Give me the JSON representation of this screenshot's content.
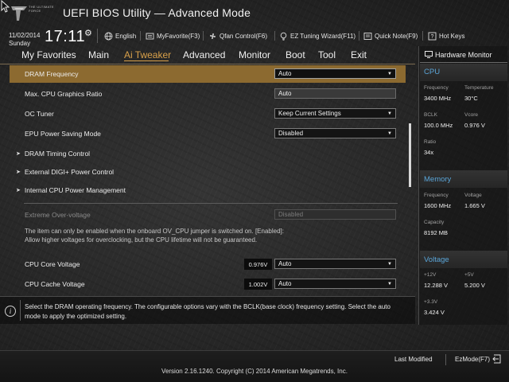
{
  "header": {
    "logo_text": "THE ULTIMATE FORCE",
    "title": "UEFI BIOS Utility — Advanced Mode",
    "date": "11/02/2014",
    "day": "Sunday",
    "time": "17:11",
    "tools": [
      {
        "label": "English",
        "icon": "globe-icon"
      },
      {
        "label": "MyFavorite(F3)",
        "icon": "favorite-icon"
      },
      {
        "label": "Qfan Control(F6)",
        "icon": "fan-icon"
      },
      {
        "label": "EZ Tuning Wizard(F11)",
        "icon": "lightbulb-icon"
      },
      {
        "label": "Quick Note(F9)",
        "icon": "note-icon"
      },
      {
        "label": "Hot Keys",
        "icon": "help-icon"
      }
    ]
  },
  "tabs": [
    {
      "label": "My Favorites",
      "active": false
    },
    {
      "label": "Main",
      "active": false
    },
    {
      "label": "Ai Tweaker",
      "active": true
    },
    {
      "label": "Advanced",
      "active": false
    },
    {
      "label": "Monitor",
      "active": false
    },
    {
      "label": "Boot",
      "active": false
    },
    {
      "label": "Tool",
      "active": false
    },
    {
      "label": "Exit",
      "active": false
    }
  ],
  "settings": {
    "dram_frequency": {
      "label": "DRAM Frequency",
      "value": "Auto"
    },
    "cpu_graphics_ratio": {
      "label": "Max. CPU Graphics Ratio",
      "value": "Auto"
    },
    "oc_tuner": {
      "label": "OC Tuner",
      "value": "Keep Current Settings"
    },
    "epu_power": {
      "label": "EPU Power Saving Mode",
      "value": "Disabled"
    },
    "dram_timing": {
      "label": "DRAM Timing Control"
    },
    "digi_power": {
      "label": "External DIGI+ Power Control"
    },
    "internal_cpu_power": {
      "label": "Internal CPU Power Management"
    },
    "extreme_overvoltage": {
      "label": "Extreme Over-voltage",
      "value": "Disabled"
    },
    "help_note": "The item can only be enabled when the onboard OV_CPU jumper is switched on. [Enabled]: Allow higher voltages for overclocking, but the CPU lifetime will not be guaranteed.",
    "cpu_core_voltage": {
      "label": "CPU Core Voltage",
      "reading": "0.976V",
      "value": "Auto"
    },
    "cpu_cache_voltage": {
      "label": "CPU Cache Voltage",
      "reading": "1.002V",
      "value": "Auto"
    }
  },
  "info_text": "Select the DRAM operating frequency. The configurable options vary with the BCLK(base clock) frequency setting. Select the auto mode to apply the optimized setting.",
  "hardware_monitor": {
    "title": "Hardware Monitor",
    "cpu": {
      "heading": "CPU",
      "frequency_label": "Frequency",
      "frequency": "3400 MHz",
      "temperature_label": "Temperature",
      "temperature": "30°C",
      "bclk_label": "BCLK",
      "bclk": "100.0 MHz",
      "vcore_label": "Vcore",
      "vcore": "0.976 V",
      "ratio_label": "Ratio",
      "ratio": "34x"
    },
    "memory": {
      "heading": "Memory",
      "frequency_label": "Frequency",
      "frequency": "1600 MHz",
      "voltage_label": "Voltage",
      "voltage": "1.665 V",
      "capacity_label": "Capacity",
      "capacity": "8192 MB"
    },
    "voltage": {
      "heading": "Voltage",
      "v12_label": "+12V",
      "v12": "12.288 V",
      "v5_label": "+5V",
      "v5": "5.200 V",
      "v33_label": "+3.3V",
      "v33": "3.424 V"
    }
  },
  "footer": {
    "last_modified": "Last Modified",
    "ezmode": "EzMode(F7)",
    "version": "Version 2.16.1240. Copyright (C) 2014 American Megatrends, Inc."
  },
  "colors": {
    "accent": "#d8a04a",
    "highlight_row": "#8c6a30",
    "monitor_heading": "#5aa5d8"
  }
}
